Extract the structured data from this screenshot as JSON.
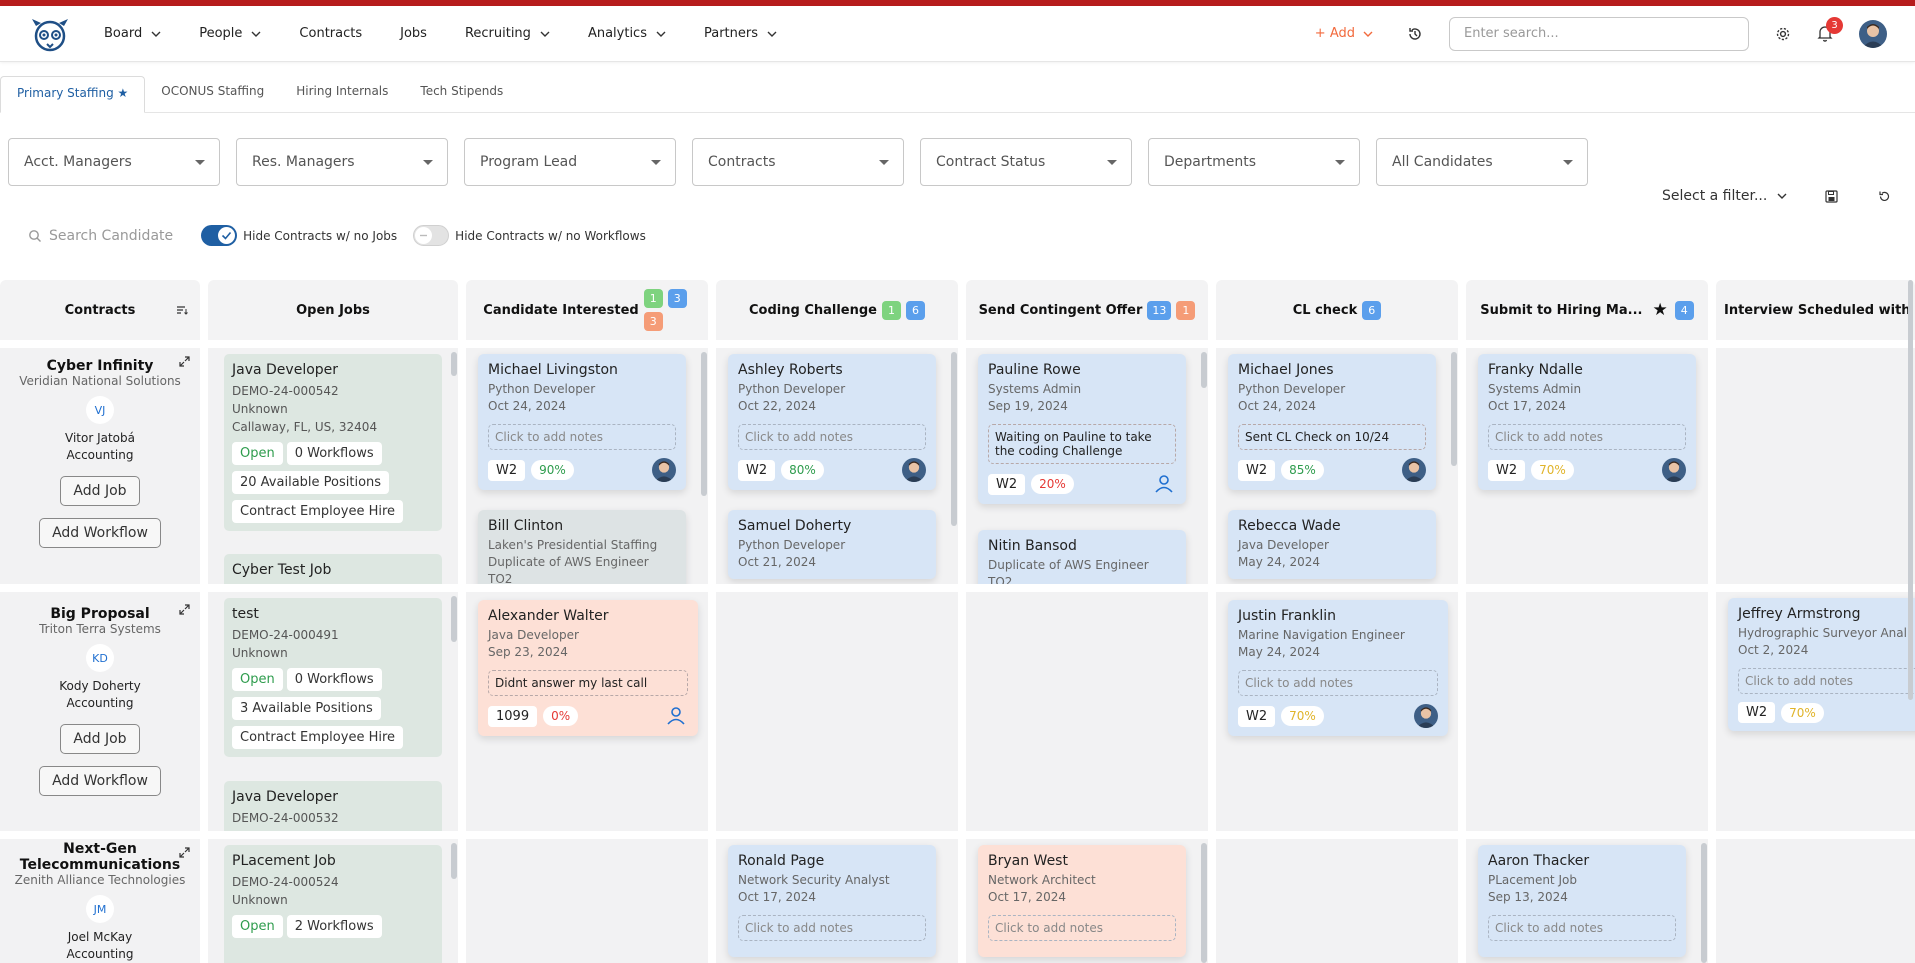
{
  "nav": {
    "items": [
      {
        "label": "Board",
        "dropdown": true
      },
      {
        "label": "People",
        "dropdown": true
      },
      {
        "label": "Contracts",
        "dropdown": false
      },
      {
        "label": "Jobs",
        "dropdown": false
      },
      {
        "label": "Recruiting",
        "dropdown": true
      },
      {
        "label": "Analytics",
        "dropdown": true
      },
      {
        "label": "Partners",
        "dropdown": true
      }
    ],
    "add_label": "+ Add",
    "search_placeholder": "Enter search...",
    "notification_count": "3"
  },
  "tabs": [
    "Primary Staffing ★",
    "OCONUS Staffing",
    "Hiring Internals",
    "Tech Stipends"
  ],
  "filters": [
    "Acct. Managers",
    "Res. Managers",
    "Program Lead",
    "Contracts",
    "Contract Status",
    "Departments",
    "All Candidates"
  ],
  "filter_select": "Select a filter...",
  "search_candidate_placeholder": "Search Candidate",
  "toggles": [
    {
      "label": "Hide Contracts w/ no Jobs",
      "on": true
    },
    {
      "label": "Hide Contracts w/ no Workflows",
      "on": false
    }
  ],
  "columns": {
    "contracts": "Contracts",
    "open_jobs": "Open Jobs",
    "stages": [
      {
        "label": "Candidate Interested",
        "badges": [
          {
            "n": "1",
            "c": "green"
          },
          {
            "n": "3",
            "c": "blue"
          },
          {
            "n": "3",
            "c": "orange"
          }
        ]
      },
      {
        "label": "Coding Challenge",
        "badges": [
          {
            "n": "1",
            "c": "green"
          },
          {
            "n": "6",
            "c": "blue"
          }
        ]
      },
      {
        "label": "Send Contingent Offer",
        "badges": [
          {
            "n": "13",
            "c": "blue"
          },
          {
            "n": "1",
            "c": "orange"
          }
        ]
      },
      {
        "label": "CL check",
        "badges": [
          {
            "n": "6",
            "c": "blue"
          }
        ]
      },
      {
        "label": "Submit to Hiring Ma...",
        "badges": [
          {
            "n": "4",
            "c": "blue"
          }
        ]
      },
      {
        "label": "Interview Scheduled with ...",
        "badges": []
      }
    ]
  },
  "rows": [
    {
      "contract": {
        "name": "Cyber Infinity",
        "org": "Veridian National Solutions",
        "initials": "VJ",
        "person": "Vitor Jatobá",
        "dept": "Accounting",
        "add_job": "Add Job",
        "add_workflow": "Add Workflow"
      },
      "jobs": [
        {
          "title": "Java Developer",
          "id": "DEMO-24-000542",
          "status_line": "Unknown",
          "location": "Callaway, FL, US, 32404",
          "open": "Open",
          "workflows": "0 Workflows",
          "positions": "20 Available Positions",
          "type": "Contract Employee Hire"
        },
        {
          "title": "Cyber Test Job"
        }
      ]
    },
    {
      "contract": {
        "name": "Big Proposal",
        "org": "Triton Terra Systems",
        "initials": "KD",
        "person": "Kody Doherty",
        "dept": "Accounting",
        "add_job": "Add Job",
        "add_workflow": "Add Workflow"
      },
      "jobs": [
        {
          "title": "test",
          "id": "DEMO-24-000491",
          "status_line": "Unknown",
          "open": "Open",
          "workflows": "0 Workflows",
          "positions": "3 Available Positions",
          "type": "Contract Employee Hire"
        },
        {
          "title": "Java Developer",
          "id": "DEMO-24-000532"
        }
      ]
    },
    {
      "contract": {
        "name": "Next-Gen Telecommunications",
        "org": "Zenith Alliance Technologies",
        "initials": "JM",
        "person": "Joel McKay",
        "dept": "Accounting"
      },
      "jobs": [
        {
          "title": "PLacement Job",
          "id": "DEMO-24-000524",
          "status_line": "Unknown",
          "open": "Open",
          "workflows": "2 Workflows"
        }
      ]
    }
  ],
  "cards": {
    "c1": {
      "name": "Michael Livingston",
      "role": "Python Developer",
      "date": "Oct 24, 2024",
      "note": "Click to add notes",
      "tag": "W2",
      "pct": "90%"
    },
    "c2": {
      "name": "Bill Clinton",
      "role": "Laken's Presidential Staffing",
      "extra": "Duplicate of AWS Engineer",
      "extra2": "TO2"
    },
    "c3": {
      "name": "Alexander Walter",
      "role": "Java Developer",
      "date": "Sep 23, 2024",
      "note": "Didnt answer my last call",
      "tag": "1099",
      "pct": "0%"
    },
    "c4": {
      "name": "Ashley Roberts",
      "role": "Python Developer",
      "date": "Oct 22, 2024",
      "note": "Click to add notes",
      "tag": "W2",
      "pct": "80%"
    },
    "c5": {
      "name": "Samuel Doherty",
      "role": "Python Developer",
      "date": "Oct 21, 2024"
    },
    "c6": {
      "name": "Ronald Page",
      "role": "Network Security Analyst",
      "date": "Oct 17, 2024",
      "note": "Click to add notes"
    },
    "c7": {
      "name": "Pauline Rowe",
      "role": "Systems Admin",
      "date": "Sep 19, 2024",
      "note": "Waiting on Pauline to take the coding Challenge",
      "tag": "W2",
      "pct": "20%"
    },
    "c8": {
      "name": "Nitin Bansod",
      "role": "Duplicate of AWS Engineer",
      "extra": "TO2"
    },
    "c9": {
      "name": "Bryan West",
      "role": "Network Architect",
      "date": "Oct 17, 2024",
      "note": "Click to add notes"
    },
    "c10": {
      "name": "Michael Jones",
      "role": "Python Developer",
      "date": "Oct 24, 2024",
      "note": "Sent CL Check on 10/24",
      "tag": "W2",
      "pct": "85%"
    },
    "c11": {
      "name": "Rebecca Wade",
      "role": "Java Developer",
      "date": "May 24, 2024"
    },
    "c12": {
      "name": "Justin Franklin",
      "role": "Marine Navigation Engineer",
      "date": "May 24, 2024",
      "note": "Click to add notes",
      "tag": "W2",
      "pct": "70%"
    },
    "c13": {
      "name": "Franky Ndalle",
      "role": "Systems Admin",
      "date": "Oct 17, 2024",
      "note": "Click to add notes",
      "tag": "W2",
      "pct": "70%"
    },
    "c14": {
      "name": "Aaron Thacker",
      "role": "PLacement Job",
      "date": "Sep 13, 2024",
      "note": "Click to add notes"
    },
    "c15": {
      "name": "Jeffrey Armstrong",
      "role": "Hydrographic Surveyor Anal",
      "date": "Oct 2, 2024",
      "note": "Click to add notes",
      "tag": "W2",
      "pct": "70%"
    }
  }
}
